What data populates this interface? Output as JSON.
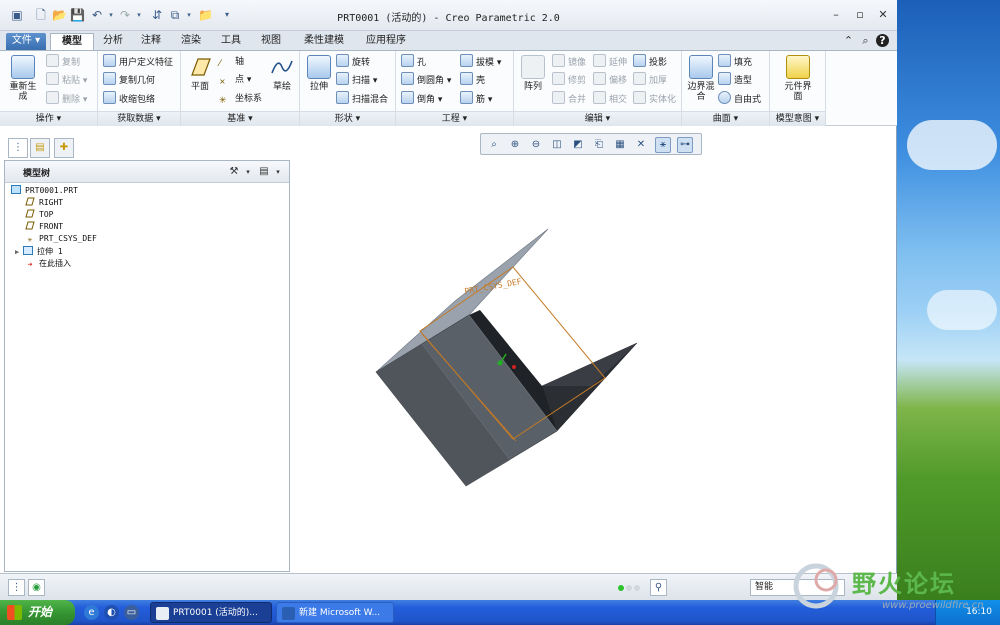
{
  "window": {
    "title": "PRT0001 (活动的) - Creo Parametric 2.0",
    "minimize": "–",
    "maximize": "▫",
    "close": "✕"
  },
  "tabs": [
    {
      "label": "文件 ▾",
      "active": false
    },
    {
      "label": "模型",
      "active": true
    },
    {
      "label": "分析",
      "active": false
    },
    {
      "label": "注释",
      "active": false
    },
    {
      "label": "渲染",
      "active": false
    },
    {
      "label": "工具",
      "active": false
    },
    {
      "label": "视图",
      "active": false
    },
    {
      "label": "柔性建模",
      "active": false
    },
    {
      "label": "应用程序",
      "active": false
    }
  ],
  "ribbon": {
    "operations": {
      "label": "操作 ▾",
      "regenerate": "重新生成",
      "copy": "复制",
      "paste": "粘贴 ▾",
      "delete": "删除 ▾"
    },
    "get_data": {
      "label": "获取数据 ▾",
      "udf": "用户定义特征",
      "copy_geom": "复制几何",
      "shrinkwrap": "收缩包络"
    },
    "datum": {
      "label": "基准 ▾",
      "plane": "平面",
      "axis": "轴",
      "point": "点 ▾",
      "csys": "坐标系",
      "sketch": "草绘"
    },
    "shapes": {
      "label": "形状 ▾",
      "extrude": "拉伸",
      "revolve": "旋转",
      "sweep": "扫描 ▾",
      "swept_blend": "扫描混合"
    },
    "engineering": {
      "label": "工程 ▾",
      "hole": "孔",
      "round": "倒圆角 ▾",
      "chamfer": "倒角 ▾",
      "draft": "拔模 ▾",
      "shell": "壳",
      "rib": "筋 ▾"
    },
    "editing": {
      "label": "编辑 ▾",
      "pattern": "阵列",
      "mirror": "镜像",
      "trim": "修剪",
      "merge": "合并",
      "extend": "延伸",
      "offset": "偏移",
      "intersect": "相交",
      "project": "投影",
      "thicken": "加厚",
      "solidify": "实体化"
    },
    "surfaces": {
      "label": "曲面 ▾",
      "boundary_blend": "边界混合",
      "fill": "填充",
      "style": "造型",
      "freestyle": "自由式"
    },
    "model_intent": {
      "label": "模型意图 ▾",
      "component_interface": "元件界面"
    }
  },
  "tree": {
    "title": "模型树",
    "nodes": [
      {
        "label": "PRT0001.PRT",
        "icon": "part-icon",
        "indent": 0
      },
      {
        "label": "RIGHT",
        "icon": "datum-plane-icon",
        "indent": 1
      },
      {
        "label": "TOP",
        "icon": "datum-plane-icon",
        "indent": 1
      },
      {
        "label": "FRONT",
        "icon": "datum-plane-icon",
        "indent": 1
      },
      {
        "label": "PRT_CSYS_DEF",
        "icon": "csys-icon",
        "indent": 1
      },
      {
        "label": "拉伸 1",
        "icon": "extrude-icon",
        "indent": 1
      },
      {
        "label": "在此插入",
        "icon": "insert-here-icon",
        "indent": 1
      }
    ]
  },
  "graphics": {
    "csys_label": "PRT_CSYS_DEF"
  },
  "status": {
    "filter_value": "智能"
  },
  "taskbar": {
    "start": "开始",
    "tasks": [
      {
        "label": "PRT0001 (活动的)...",
        "active": true
      },
      {
        "label": "新建 Microsoft W...",
        "active": false
      }
    ],
    "clock": "16:10"
  },
  "watermark": {
    "text": "野火论坛",
    "url": "www.proewildfire.cn"
  },
  "colors": {
    "accent": "#3a6fb0",
    "taskbar": "#245edb",
    "start_button": "#359632"
  }
}
